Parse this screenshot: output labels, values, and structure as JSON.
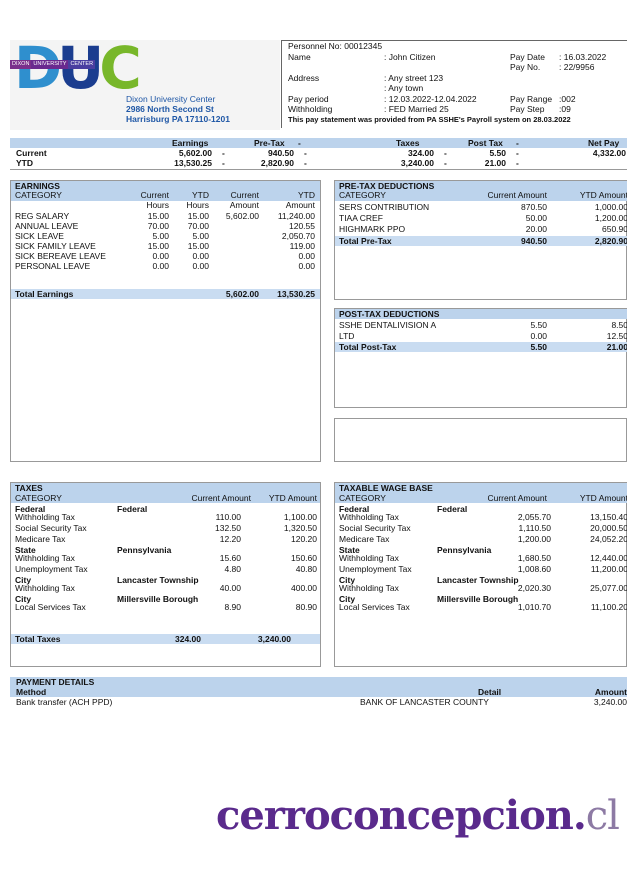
{
  "logo": {
    "letters": [
      "D",
      "U",
      "C"
    ],
    "band": [
      "DIXON",
      "UNIVERSITY",
      "CENTER"
    ]
  },
  "university": {
    "name": "Dixon University Center",
    "street": "2986 North Second St",
    "city": "Harrisburg PA 17110-1201"
  },
  "info": {
    "personnel_no": "Personnel No: 00012345",
    "name_label": "Name",
    "name_value": ": John Citizen",
    "address_label": "Address",
    "address_line1": ": Any street 123",
    "address_line2": ": Any town",
    "pay_period_label": "Pay period",
    "pay_period_value": ": 12.03.2022-12.04.2022",
    "withholding_label": "Withholding",
    "withholding_value": ": FED Married 25",
    "pay_date_label": "Pay Date",
    "pay_date_value": ": 16.03.2022",
    "pay_no_label": "Pay No.",
    "pay_no_value": ": 22/9956",
    "pay_range_label": "Pay Range",
    "pay_range_value": ":002",
    "pay_step_label": "Pay Step",
    "pay_step_value": ":09",
    "provided_note": "This pay statement was provided from PA SSHE's Payroll system on 28.03.2022"
  },
  "summary": {
    "headers": [
      "Earnings",
      "Pre-Tax",
      "Taxes",
      "Post Tax",
      "Net Pay"
    ],
    "rows": [
      {
        "label": "Current",
        "earnings": "5,602.00",
        "pretax": "940.50",
        "taxes": "324.00",
        "posttax": "5.50",
        "net": "4,332.00"
      },
      {
        "label": "YTD",
        "earnings": "13,530.25",
        "pretax": "2,820.90",
        "taxes": "3,240.00",
        "posttax": "21.00",
        "net": ""
      }
    ],
    "dash": "-"
  },
  "earnings": {
    "title": "EARNINGS",
    "headers": {
      "category": "CATEGORY",
      "cur_hours": "Current Hours",
      "ytd_hours": "YTD Hours",
      "cur_amount": "Current Amount",
      "ytd_amount": "YTD Amount"
    },
    "h1": [
      "Current",
      "YTD",
      "Current",
      "YTD"
    ],
    "h2": [
      "Hours",
      "Hours",
      "Amount",
      "Amount"
    ],
    "rows": [
      [
        "REG SALARY",
        "15.00",
        "15.00",
        "5,602.00",
        "11,240.00"
      ],
      [
        "ANNUAL LEAVE",
        "70.00",
        "70.00",
        "",
        "120.55"
      ],
      [
        "SICK LEAVE",
        "5.00",
        "5.00",
        "",
        "2,050.70"
      ],
      [
        "SICK FAMILY LEAVE",
        "15.00",
        "15.00",
        "",
        "119.00"
      ],
      [
        "SICK BEREAVE LEAVE",
        "0.00",
        "0.00",
        "",
        "0.00"
      ],
      [
        "PERSONAL LEAVE",
        "0.00",
        "0.00",
        "",
        "0.00"
      ]
    ],
    "total_label": "Total Earnings",
    "total_current": "5,602.00",
    "total_ytd": "13,530.25"
  },
  "pretax": {
    "title": "PRE-TAX DEDUCTIONS",
    "headers": [
      "CATEGORY",
      "Current Amount",
      "YTD Amount"
    ],
    "rows": [
      [
        "SERS CONTRIBUTION",
        "870.50",
        "1,000.00"
      ],
      [
        "TIAA CREF",
        "50.00",
        "1,200.00"
      ],
      [
        "HIGHMARK PPO",
        "20.00",
        "650.90"
      ]
    ],
    "total_label": "Total Pre-Tax",
    "total_current": "940.50",
    "total_ytd": "2,820.90"
  },
  "posttax": {
    "title": "POST-TAX DEDUCTIONS",
    "rows": [
      [
        "SSHE DENTALIVISION A",
        "5.50",
        "8.50"
      ],
      [
        "LTD",
        "0.00",
        "12.50"
      ]
    ],
    "total_label": "Total Post-Tax",
    "total_current": "5.50",
    "total_ytd": "21.00"
  },
  "taxes": {
    "title": "TAXES",
    "headers": [
      "CATEGORY",
      "Current Amount",
      "YTD Amount"
    ],
    "groups": [
      {
        "name": "Federal",
        "juris": "Federal",
        "rows": [
          [
            "Withholding Tax",
            "110.00",
            "1,100.00"
          ],
          [
            "Social Security Tax",
            "132.50",
            "1,320.50"
          ],
          [
            "Medicare Tax",
            "12.20",
            "120.20"
          ]
        ]
      },
      {
        "name": "State",
        "juris": "Pennsylvania",
        "rows": [
          [
            "Withholding Tax",
            "15.60",
            "150.60"
          ],
          [
            "Unemployment Tax",
            "4.80",
            "40.80"
          ]
        ]
      },
      {
        "name": "City",
        "juris": "Lancaster Township",
        "rows": [
          [
            "Withholding Tax",
            "40.00",
            "400.00"
          ]
        ]
      },
      {
        "name": "City",
        "juris": "Millersville Borough",
        "rows": [
          [
            "Local Services Tax",
            "8.90",
            "80.90"
          ]
        ]
      }
    ],
    "total_label": "Total Taxes",
    "total_current": "324.00",
    "total_ytd": "3,240.00"
  },
  "wage_base": {
    "title": "TAXABLE WAGE BASE",
    "headers": [
      "CATEGORY",
      "Current Amount",
      "YTD Amount"
    ],
    "groups": [
      {
        "name": "Federal",
        "juris": "Federal",
        "rows": [
          [
            "Withholding Tax",
            "2,055.70",
            "13,150.40"
          ],
          [
            "Social Security Tax",
            "1,110.50",
            "20,000.50"
          ],
          [
            "Medicare Tax",
            "1,200.00",
            "24,052.20"
          ]
        ]
      },
      {
        "name": "State",
        "juris": "Pennsylvania",
        "rows": [
          [
            "Withholding Tax",
            "1,680.50",
            "12,440.00"
          ],
          [
            "Unemployment Tax",
            "1,008.60",
            "11,200.00"
          ]
        ]
      },
      {
        "name": "City",
        "juris": "Lancaster Township",
        "rows": [
          [
            "Withholding Tax",
            "2,020.30",
            "25,077.00"
          ]
        ]
      },
      {
        "name": "City",
        "juris": "Millersville Borough",
        "rows": [
          [
            "Local Services Tax",
            "1,010.70",
            "11,100.20"
          ]
        ]
      }
    ]
  },
  "payment": {
    "title": "PAYMENT DETAILS",
    "headers": [
      "Method",
      "Detail",
      "Amount"
    ],
    "row": [
      "Bank transfer (ACH PPD)",
      "BANK OF LANCASTER COUNTY",
      "3,240.00"
    ]
  },
  "watermark": {
    "main": "cerroconcepcion",
    "dot": ".",
    "tld": "cl"
  },
  "colors": {
    "section_bar": "#bcd3ec",
    "logo_blue": "#2f8fce",
    "logo_navy": "#1b3d8f",
    "logo_green": "#78b72a",
    "watermark": "#5a2a8c"
  }
}
